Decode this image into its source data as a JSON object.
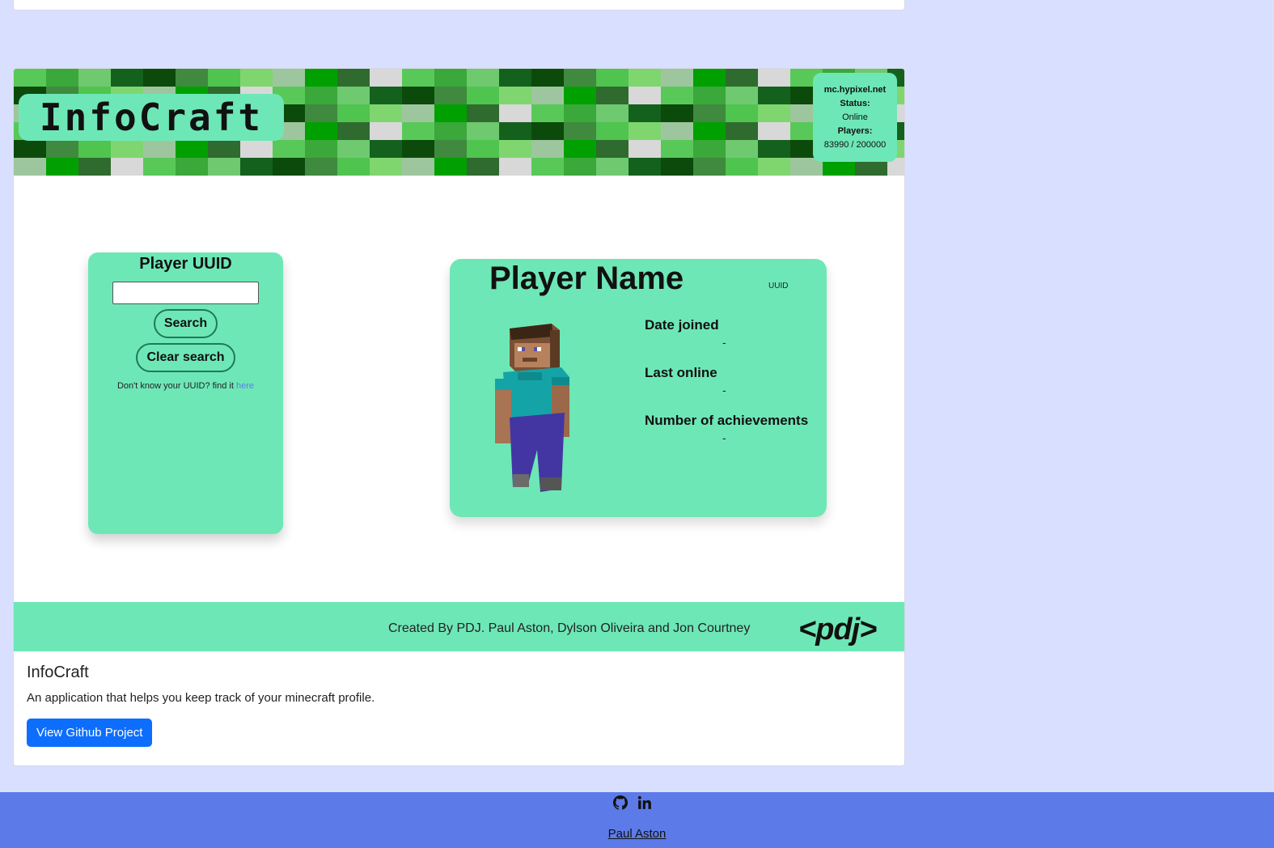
{
  "project": {
    "title": "InfoCraft",
    "description": "An application that helps you keep track of your minecraft profile.",
    "button_label": "View Github Project"
  },
  "screenshot": {
    "logo_text": "InfoCraft",
    "server": {
      "host": "mc.hypixel.net",
      "status_label": "Status:",
      "status_value": "Online",
      "players_label": "Players:",
      "players_value": "83990 / 200000"
    },
    "search_panel": {
      "title": "Player UUID",
      "input_value": "",
      "search_label": "Search",
      "clear_label": "Clear search",
      "help_text": "Don't know your UUID? find it",
      "help_link": "here"
    },
    "player_card": {
      "name": "Player Name",
      "uuid_label": "UUID",
      "stats": [
        {
          "label": "Date joined",
          "value": "-"
        },
        {
          "label": "Last online",
          "value": "-"
        },
        {
          "label": "Number of achievements",
          "value": "-"
        }
      ]
    },
    "footer": {
      "credits": "Created By PDJ. Paul Aston, Dylson Oliveira and Jon Courtney",
      "logo": "<pdj>"
    }
  },
  "site_footer": {
    "icons": [
      "github-icon",
      "linkedin-icon"
    ],
    "author": "Paul Aston"
  },
  "colors": {
    "page_bg": "#d9e0ff",
    "mint": "#6ee7b7",
    "primary_button": "#0d6efd",
    "footer_bg": "#5c7be8"
  }
}
